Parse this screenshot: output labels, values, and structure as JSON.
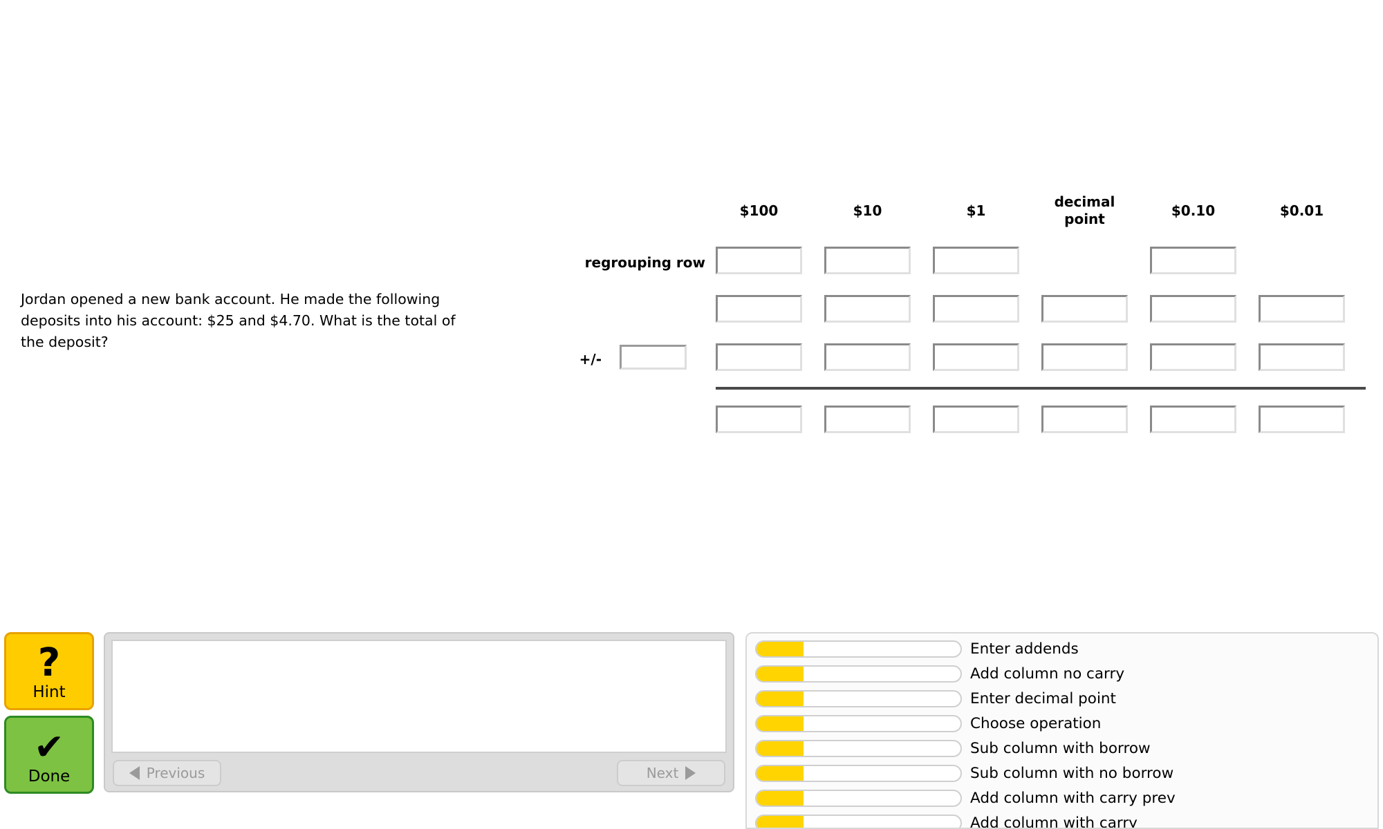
{
  "problem": {
    "statement": "Jordan opened a new bank account. He made the following deposits into his account: $25 and $4.70. What is the total of the deposit?"
  },
  "worksheet": {
    "columns": [
      {
        "header": "$100",
        "lines": [
          "$100"
        ]
      },
      {
        "header": "$10",
        "lines": [
          "$10"
        ]
      },
      {
        "header": "$1",
        "lines": [
          "$1"
        ]
      },
      {
        "header": "decimal point",
        "lines": [
          "decimal",
          "point"
        ]
      },
      {
        "header": "$0.10",
        "lines": [
          "$0.10"
        ]
      },
      {
        "header": "$0.01",
        "lines": [
          "$0.01"
        ]
      }
    ],
    "regrouping_row_label": "regrouping row",
    "operator_row_label": "+/-",
    "operator_value": "",
    "rows": [
      {
        "name": "regrouping",
        "cells": [
          "",
          "",
          "",
          null,
          "",
          null
        ]
      },
      {
        "name": "addend-1",
        "cells": [
          "",
          "",
          "",
          "",
          "",
          ""
        ]
      },
      {
        "name": "addend-2",
        "cells": [
          "",
          "",
          "",
          "",
          "",
          ""
        ]
      },
      {
        "name": "answer",
        "cells": [
          "",
          "",
          "",
          "",
          "",
          ""
        ]
      }
    ]
  },
  "controls": {
    "hint_label": "Hint",
    "hint_glyph": "?",
    "done_label": "Done",
    "done_glyph": "✔"
  },
  "hint_panel": {
    "content": "",
    "previous_label": "Previous",
    "next_label": "Next"
  },
  "skills": {
    "items": [
      {
        "label": "Enter addends",
        "progress": 23
      },
      {
        "label": "Add column no carry",
        "progress": 23
      },
      {
        "label": "Enter decimal point",
        "progress": 23
      },
      {
        "label": "Choose operation",
        "progress": 23
      },
      {
        "label": "Sub column with borrow",
        "progress": 23
      },
      {
        "label": "Sub column with no borrow",
        "progress": 23
      },
      {
        "label": "Add column with carry prev",
        "progress": 23
      },
      {
        "label": "Add column with carry",
        "progress": 23
      }
    ]
  },
  "colors": {
    "hint_bg": "#FFCC00",
    "hint_border": "#E8A200",
    "done_bg": "#7DC242",
    "done_border": "#2E8B22",
    "skill_fill": "#FFD400",
    "rule": "#4A4A4A"
  }
}
